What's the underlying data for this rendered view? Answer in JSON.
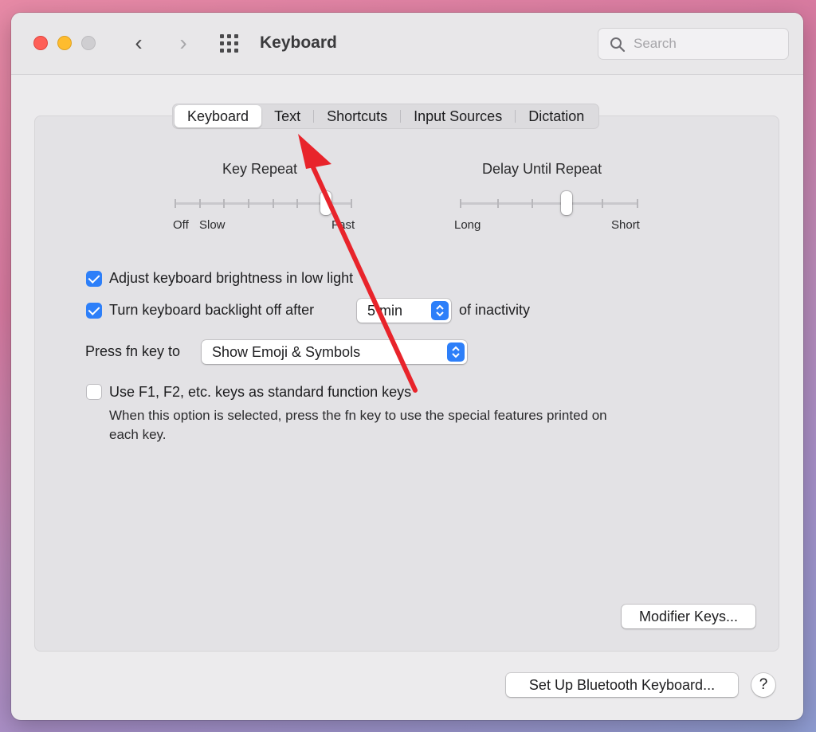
{
  "window": {
    "title": "Keyboard"
  },
  "search": {
    "placeholder": "Search"
  },
  "tabs": [
    {
      "label": "Keyboard",
      "selected": true
    },
    {
      "label": "Text",
      "selected": false
    },
    {
      "label": "Shortcuts",
      "selected": false
    },
    {
      "label": "Input Sources",
      "selected": false
    },
    {
      "label": "Dictation",
      "selected": false
    }
  ],
  "key_repeat": {
    "title": "Key Repeat",
    "labels": {
      "off": "Off",
      "slow": "Slow",
      "fast": "Fast"
    },
    "level": 0.85
  },
  "delay_until_repeat": {
    "title": "Delay Until Repeat",
    "labels": {
      "long": "Long",
      "short": "Short"
    },
    "level": 0.6
  },
  "options": {
    "brightness": {
      "label": "Adjust keyboard brightness in low light",
      "checked": true
    },
    "backlight": {
      "label": "Turn keyboard backlight off after",
      "value": "5 min",
      "suffix": "of inactivity",
      "checked": true
    },
    "fn_key": {
      "label": "Press fn key to",
      "value": "Show Emoji & Symbols"
    },
    "function_keys": {
      "label": "Use F1, F2, etc. keys as standard function keys",
      "help_line1": "When this option is selected, press the fn key to use the special features printed on",
      "help_line2": "each key.",
      "checked": false
    }
  },
  "buttons": {
    "modifier_keys": "Modifier Keys...",
    "bluetooth": "Set Up Bluetooth Keyboard...",
    "help": "?"
  },
  "colors": {
    "accent": "#2d7ff9",
    "annotation_arrow": "#e8242b"
  }
}
